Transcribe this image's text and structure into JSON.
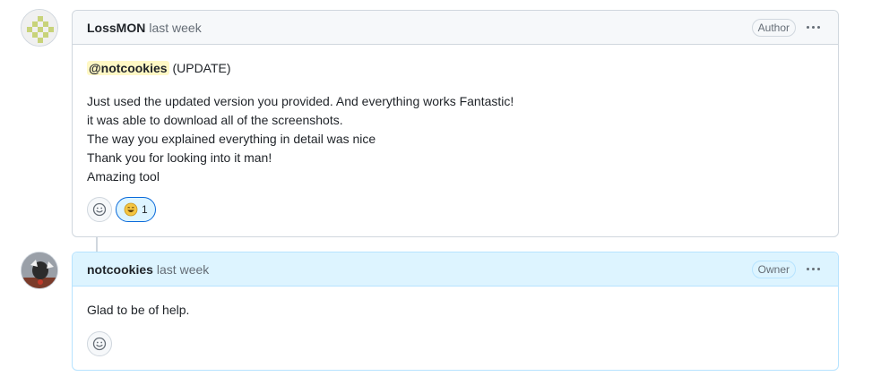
{
  "comments": [
    {
      "author": "LossMON",
      "timestamp": "last week",
      "role": "Author",
      "mention": "@notcookies",
      "mention_suffix": " (UPDATE)",
      "lines": [
        "Just used the updated version you provided. And everything works Fantastic!",
        "it was able to download all of the screenshots.",
        "The way you explained everything in detail was nice",
        "Thank you for looking into it man!",
        "Amazing tool"
      ],
      "reaction": {
        "icon": "laugh-emoji-icon",
        "count": "1"
      }
    },
    {
      "author": "notcookies",
      "timestamp": "last week",
      "role": "Owner",
      "body": "Glad to be of help."
    }
  ],
  "colors": {
    "accent": "#0969da",
    "owner_header": "#ddf4ff",
    "mention_bg": "#fff8c5"
  }
}
